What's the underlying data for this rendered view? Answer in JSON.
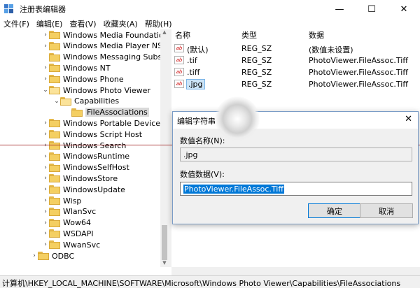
{
  "window": {
    "title": "注册表编辑器",
    "minimize": "—",
    "maximize": "☐",
    "close": "✕"
  },
  "menu": [
    "文件(F)",
    "编辑(E)",
    "查看(V)",
    "收藏夹(A)",
    "帮助(H)"
  ],
  "tree": {
    "items": [
      {
        "label": "Windows Media Foundation",
        "expander": "›",
        "depth": 0
      },
      {
        "label": "Windows Media Player NSS",
        "expander": "›",
        "depth": 0
      },
      {
        "label": "Windows Messaging Subsys",
        "expander": "",
        "depth": 0
      },
      {
        "label": "Windows NT",
        "expander": "›",
        "depth": 0
      },
      {
        "label": "Windows Phone",
        "expander": "›",
        "depth": 0
      },
      {
        "label": "Windows Photo Viewer",
        "expander": "⌄",
        "depth": 0
      },
      {
        "label": "Capabilities",
        "expander": "⌄",
        "depth": 1
      },
      {
        "label": "FileAssociations",
        "expander": "",
        "depth": 2
      },
      {
        "label": "Windows Portable Devices",
        "expander": "›",
        "depth": 0
      },
      {
        "label": "Windows Script Host",
        "expander": "›",
        "depth": 0
      },
      {
        "label": "Windows Search",
        "expander": "›",
        "depth": 0
      },
      {
        "label": "WindowsRuntime",
        "expander": "›",
        "depth": 0
      },
      {
        "label": "WindowsSelfHost",
        "expander": "›",
        "depth": 0
      },
      {
        "label": "WindowsStore",
        "expander": "›",
        "depth": 0
      },
      {
        "label": "WindowsUpdate",
        "expander": "›",
        "depth": 0
      },
      {
        "label": "Wisp",
        "expander": "›",
        "depth": 0
      },
      {
        "label": "WlanSvc",
        "expander": "›",
        "depth": 0
      },
      {
        "label": "Wow64",
        "expander": "›",
        "depth": 0
      },
      {
        "label": "WSDAPI",
        "expander": "›",
        "depth": 0
      },
      {
        "label": "WwanSvc",
        "expander": "›",
        "depth": 0
      },
      {
        "label": "ODBC",
        "expander": "›",
        "depth": -1
      }
    ]
  },
  "values": {
    "headers": [
      "名称",
      "类型",
      "数据"
    ],
    "rows": [
      {
        "name": "(默认)",
        "type": "REG_SZ",
        "data": "(数值未设置)"
      },
      {
        "name": ".tif",
        "type": "REG_SZ",
        "data": "PhotoViewer.FileAssoc.Tiff"
      },
      {
        "name": ".tiff",
        "type": "REG_SZ",
        "data": "PhotoViewer.FileAssoc.Tiff"
      },
      {
        "name": ".jpg",
        "type": "REG_SZ",
        "data": "PhotoViewer.FileAssoc.Tiff"
      }
    ],
    "icon_text": "ab"
  },
  "dialog": {
    "title": "编辑字符串",
    "close": "✕",
    "name_label": "数值名称(N):",
    "name_value": ".jpg",
    "data_label": "数值数据(V):",
    "data_value": "PhotoViewer.FileAssoc.Tiff",
    "ok": "确定",
    "cancel": "取消"
  },
  "status": {
    "path": "计算机\\HKEY_LOCAL_MACHINE\\SOFTWARE\\Microsoft\\Windows Photo Viewer\\Capabilities\\FileAssociations"
  },
  "colors": {
    "folder": "#f4cf62",
    "selection": "#0078d7",
    "accent_line": "#a02020"
  }
}
